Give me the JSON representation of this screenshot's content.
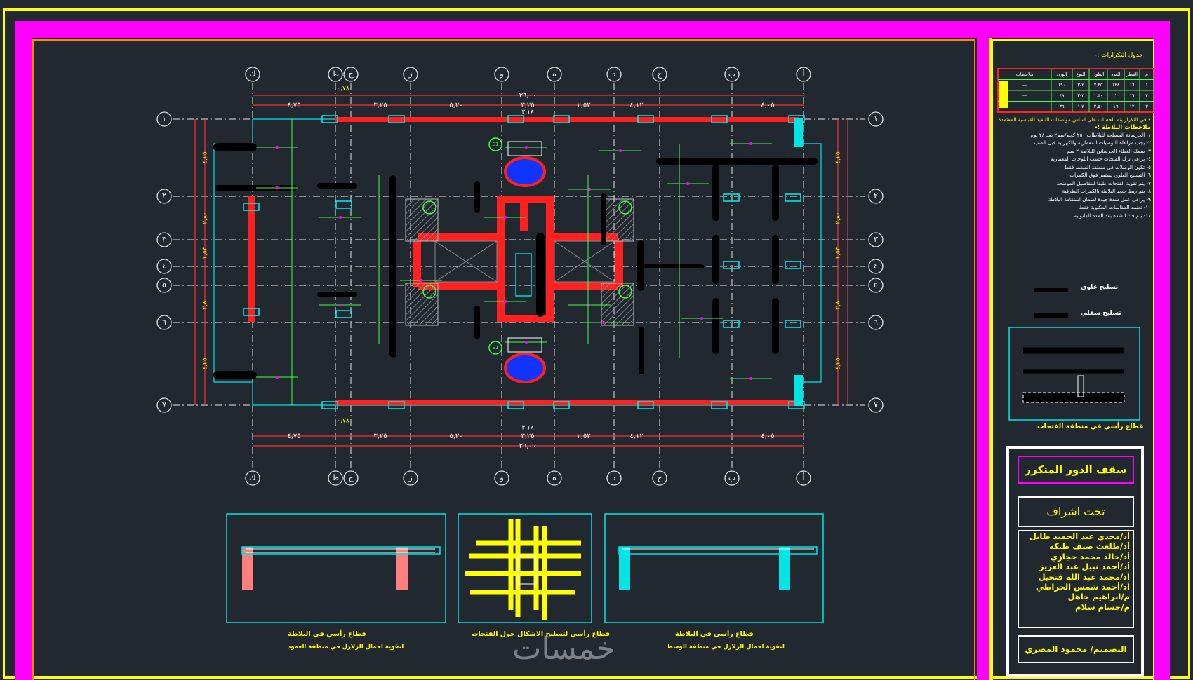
{
  "colors": {
    "background": "#212830",
    "frame_yellow": "#ffff00",
    "frame_magenta": "#ff00ff",
    "beam_red": "#ff2020",
    "column_cyan": "#00e5e5",
    "text_green": "#44ff44",
    "text_yellow": "#ffff00",
    "dim_red": "#ff3030",
    "grid_white": "#e6e6e6",
    "opening_blue": "#1133ff"
  },
  "plan": {
    "top_axis_labels": [
      "ك",
      "ط",
      "ح",
      "ز",
      "و",
      "ه",
      "د",
      "ج",
      "ب",
      "أ"
    ],
    "bottom_axis_labels": [
      "ك",
      "ط",
      "ح",
      "ز",
      "و",
      "ه",
      "د",
      "ج",
      "ب",
      "أ"
    ],
    "left_axis_labels": [
      "١",
      "٢",
      "٣",
      "٤",
      "٥",
      "٦",
      "٧"
    ],
    "right_axis_labels": [
      "١",
      "٢",
      "٣",
      "٤",
      "٥",
      "٦",
      "٧"
    ],
    "top_dimensions": [
      "٤,٧٥",
      "٣,٢٥",
      "٥,٢٠",
      "٣,٢٥",
      "٢,٥٢",
      "٤,١٢",
      "٤,٠٥"
    ],
    "top_small_dims": [
      "٠,٧٨",
      "٣,١٨"
    ],
    "top_overall": "٣٦,٠٠",
    "bottom_dimensions": [
      "٤,٧٥",
      "٣,٢٥",
      "٥,٢٠",
      "٣,٢٥",
      "٢,٥٢",
      "٤,١٢",
      "٤,٠٥"
    ],
    "bottom_small_dims": [
      "٠,٧٨",
      "٣,١٨"
    ],
    "bottom_overall": "٣٦,٠٠",
    "left_dimensions": [
      "٤,٢٥",
      "٢,٨٠",
      "١,٥٣",
      "٢,٨٠",
      "٤,٢٥"
    ],
    "right_dimensions": [
      "٤,٢٥",
      "٢,٨٠",
      "١,٥٣",
      "٢,٨٠",
      "٤,٢٥"
    ],
    "slab_marks": [
      "S1",
      "S1"
    ]
  },
  "details": {
    "detail_1_title": "قطاع رأسي في البلاطة",
    "detail_1_sub": "لتقوية احمال الزلازل في منطقة العمود",
    "detail_2_title": "قطاع رأسي لتسليح الاشكال حول الفتحات",
    "detail_3_title": "قطاع رأسي في البلاطة",
    "detail_3_sub": "لتقوية احمال الزلازل في منطقة الوسط",
    "right_detail_title": "قطاع رأسي في منطقة الفتحات"
  },
  "sidebar": {
    "table_title": "جدول التكرارات :-",
    "table_headers": [
      "م",
      "القطر",
      "العدد",
      "الطول",
      "النوع",
      "الوزن",
      "ملاحظات"
    ],
    "table_rows": [
      [
        "١",
        "١٦",
        "١٢٨",
        "٧,٣٥",
        "٢-٣",
        "١٩٠",
        "—"
      ],
      [
        "٢",
        "١٦",
        "٢٠",
        "١,٥٠",
        "٢-٣",
        "٤٩",
        "—"
      ],
      [
        "٣",
        "١٢",
        "١٦",
        "٢,٥٠",
        "٢-١",
        "٣٦",
        "—"
      ]
    ],
    "notes_heading": "ملاحظات البلاطة :-",
    "notes_intro": "• في التكرار يتم الحساب على اساس مواصفات التنفيذ القياسية المعتمدة",
    "notes": [
      "١- الخرسانة المسلحة للبلاطات ٢٥٠ كجم/سم٢ بعد ٢٨ يوم",
      "٢- يجب مراعاة التوصيات المعمارية والكهربية قبل الصب",
      "٣- سمك الغطاء الخرساني للبلاطة ٢ سم",
      "٤- يراعى ترك الفتحات حسب اللوحات المعمارية",
      "٥- تكون الوصلات في منطقة الضغط فقط",
      "٦- التسليح العلوي يستمر فوق الكمرات",
      "٧- يتم تقوية الفتحات طبقا للتفاصيل الموضحة",
      "٨- يتم ربط حديد البلاطة بالكمرات الطرفية",
      "٩- يراعى عمل شدة جيدة لضمان استقامة البلاطة",
      "١٠- تعتمد المقاسات المكتوبة فقط",
      "١١- يتم فك الشدة بعد المدة القانونية"
    ],
    "legend_1": "تسليح علوي",
    "legend_2": "تسليح سفلي",
    "title_block": {
      "project": "سقف الدور المتكرر",
      "supervision": "تحت اشراف",
      "names": [
        "أد/مجدي عبد الحميد طابل",
        "أد/طلعت صيف طبكة",
        "أد/خالد محمد حجازي",
        "أد/أحمد نبيل عبد العزيز",
        "أد/محمد عبد الله فتحيل",
        "أد/أحمد شمس الخراطي",
        "م/ابراهيم جاهل",
        "م/حسام سلام"
      ],
      "designer": "التصميم/ محمود المصري"
    }
  },
  "watermark": "خمسات"
}
